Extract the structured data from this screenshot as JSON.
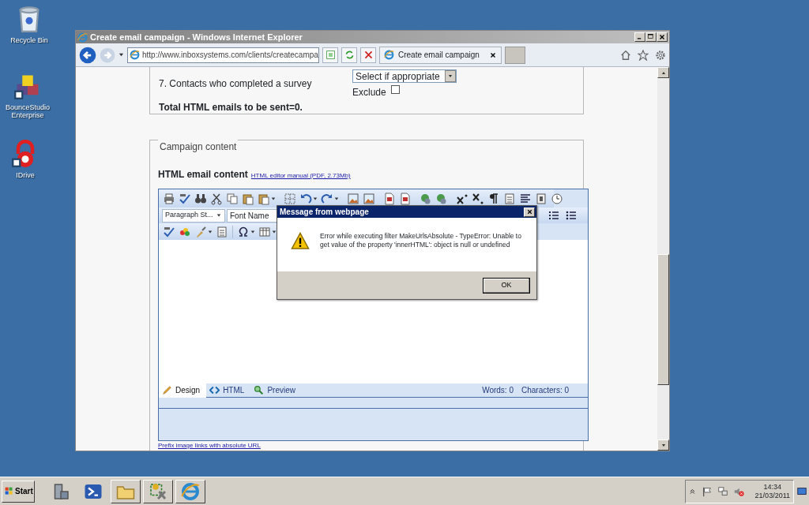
{
  "desktop_icons": [
    {
      "label": "Recycle Bin"
    },
    {
      "label": "BounceStudio Enterprise"
    },
    {
      "label": "IDrive"
    }
  ],
  "browser": {
    "title": "Create email campaign - Windows Internet Explorer",
    "address": "http://www.inboxsystems.com/clients/createcampa",
    "tabs": [
      {
        "label": "Create email campaign",
        "selected": true
      }
    ]
  },
  "page": {
    "survey_row": {
      "label": "7. Contacts who completed a survey",
      "select": "Select if appropriate",
      "exclude_label": "Exclude",
      "exclude_checked": false
    },
    "total": "Total HTML emails to be sent=0.",
    "content_legend": "Campaign content",
    "content_heading": "HTML email content",
    "manual_link": "HTML editor manual (PDF, 2.73Mb)",
    "editor": {
      "paragraph_style": "Paragraph St...",
      "font_name": "Font Name",
      "modes": [
        {
          "label": "Design",
          "selected": true
        },
        {
          "label": "HTML",
          "selected": false
        },
        {
          "label": "Preview",
          "selected": false
        }
      ],
      "words": "Words: 0",
      "characters": "Characters: 0"
    },
    "prefix_link": "Prefix image links with absolute URL"
  },
  "dialog": {
    "title": "Message from webpage",
    "message": "Error while executing filter MakeUrlsAbsolute - TypeError: Unable to get value of the property 'innerHTML': object is null or undefined",
    "button": "OK"
  },
  "taskbar": {
    "start": "Start",
    "time": "14:34",
    "date": "21/03/2011"
  }
}
